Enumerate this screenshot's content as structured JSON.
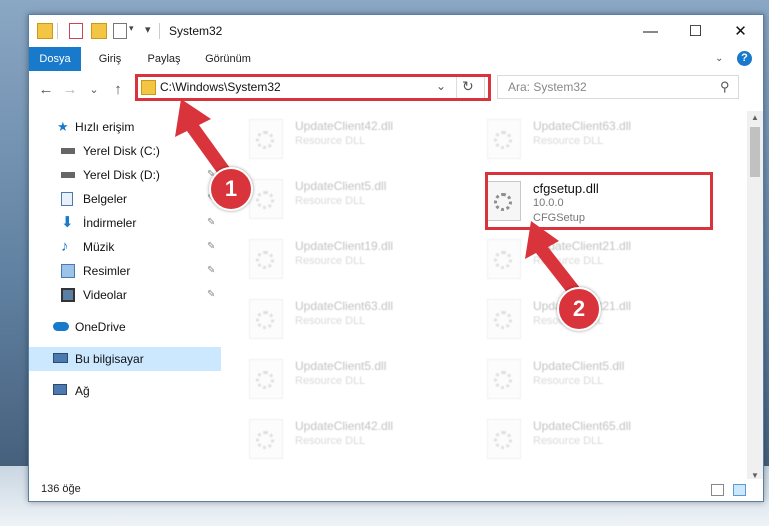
{
  "window": {
    "title": "System32",
    "minimize_label": "—",
    "maximize_label": "☐",
    "close_label": "✕",
    "help_label": "?"
  },
  "ribbon": {
    "tabs": [
      {
        "label": "Dosya",
        "active": true
      },
      {
        "label": "Giriş",
        "active": false
      },
      {
        "label": "Paylaş",
        "active": false
      },
      {
        "label": "Görünüm",
        "active": false
      }
    ]
  },
  "nav": {
    "back_label": "←",
    "forward_label": "→",
    "recent_label": "⌄",
    "up_label": "↑",
    "address": "C:\\Windows\\System32",
    "dropdown_label": "⌄",
    "refresh_label": "↻",
    "search_placeholder": "Ara: System32",
    "search_icon_label": "⚲"
  },
  "sidebar": {
    "items": [
      {
        "label": "Hızlı erişim",
        "icon": "star-icon",
        "pinned": false
      },
      {
        "label": "Yerel Disk (C:)",
        "icon": "drive-icon",
        "pinned": true
      },
      {
        "label": "Yerel Disk (D:)",
        "icon": "drive-icon",
        "pinned": true
      },
      {
        "label": "Belgeler",
        "icon": "documents-icon",
        "pinned": true
      },
      {
        "label": "İndirmeler",
        "icon": "download-icon",
        "pinned": true
      },
      {
        "label": "Müzik",
        "icon": "music-icon",
        "pinned": true
      },
      {
        "label": "Resimler",
        "icon": "pictures-icon",
        "pinned": true
      },
      {
        "label": "Videolar",
        "icon": "video-icon",
        "pinned": true
      },
      {
        "label": "OneDrive",
        "icon": "cloud-icon",
        "pinned": false
      },
      {
        "label": "Bu bilgisayar",
        "icon": "computer-icon",
        "pinned": false,
        "selected": true
      },
      {
        "label": "Ağ",
        "icon": "network-icon",
        "pinned": false
      }
    ],
    "pin_glyph": "📌"
  },
  "files": {
    "left": [
      {
        "name": "UpdateClient42.dll",
        "desc": "Resource DLL"
      },
      {
        "name": "UpdateClient5.dll",
        "desc": "Resource DLL"
      },
      {
        "name": "UpdateClient19.dll",
        "desc": "Resource DLL"
      },
      {
        "name": "UpdateClient63.dll",
        "desc": "Resource DLL"
      },
      {
        "name": "UpdateClient5.dll",
        "desc": "Resource DLL"
      },
      {
        "name": "UpdateClient42.dll",
        "desc": "Resource DLL"
      }
    ],
    "right": [
      {
        "name": "UpdateClient63.dll",
        "desc": "Resource DLL"
      },
      {
        "name": "UpdateClient21.dll",
        "desc": "Resource DLL"
      },
      {
        "name": "UpdateClient21.dll",
        "desc": "Resource DLL"
      },
      {
        "name": "UpdateClient5.dll",
        "desc": "Resource DLL"
      },
      {
        "name": "UpdateClient65.dll",
        "desc": "Resource DLL"
      }
    ],
    "highlighted": {
      "name": "cfgsetup.dll",
      "version": "10.0.0",
      "desc": "CFGSetup"
    }
  },
  "status": {
    "item_count": "136 öğe"
  },
  "annotations": {
    "badge1": "1",
    "badge2": "2",
    "color": "#d9343b"
  }
}
